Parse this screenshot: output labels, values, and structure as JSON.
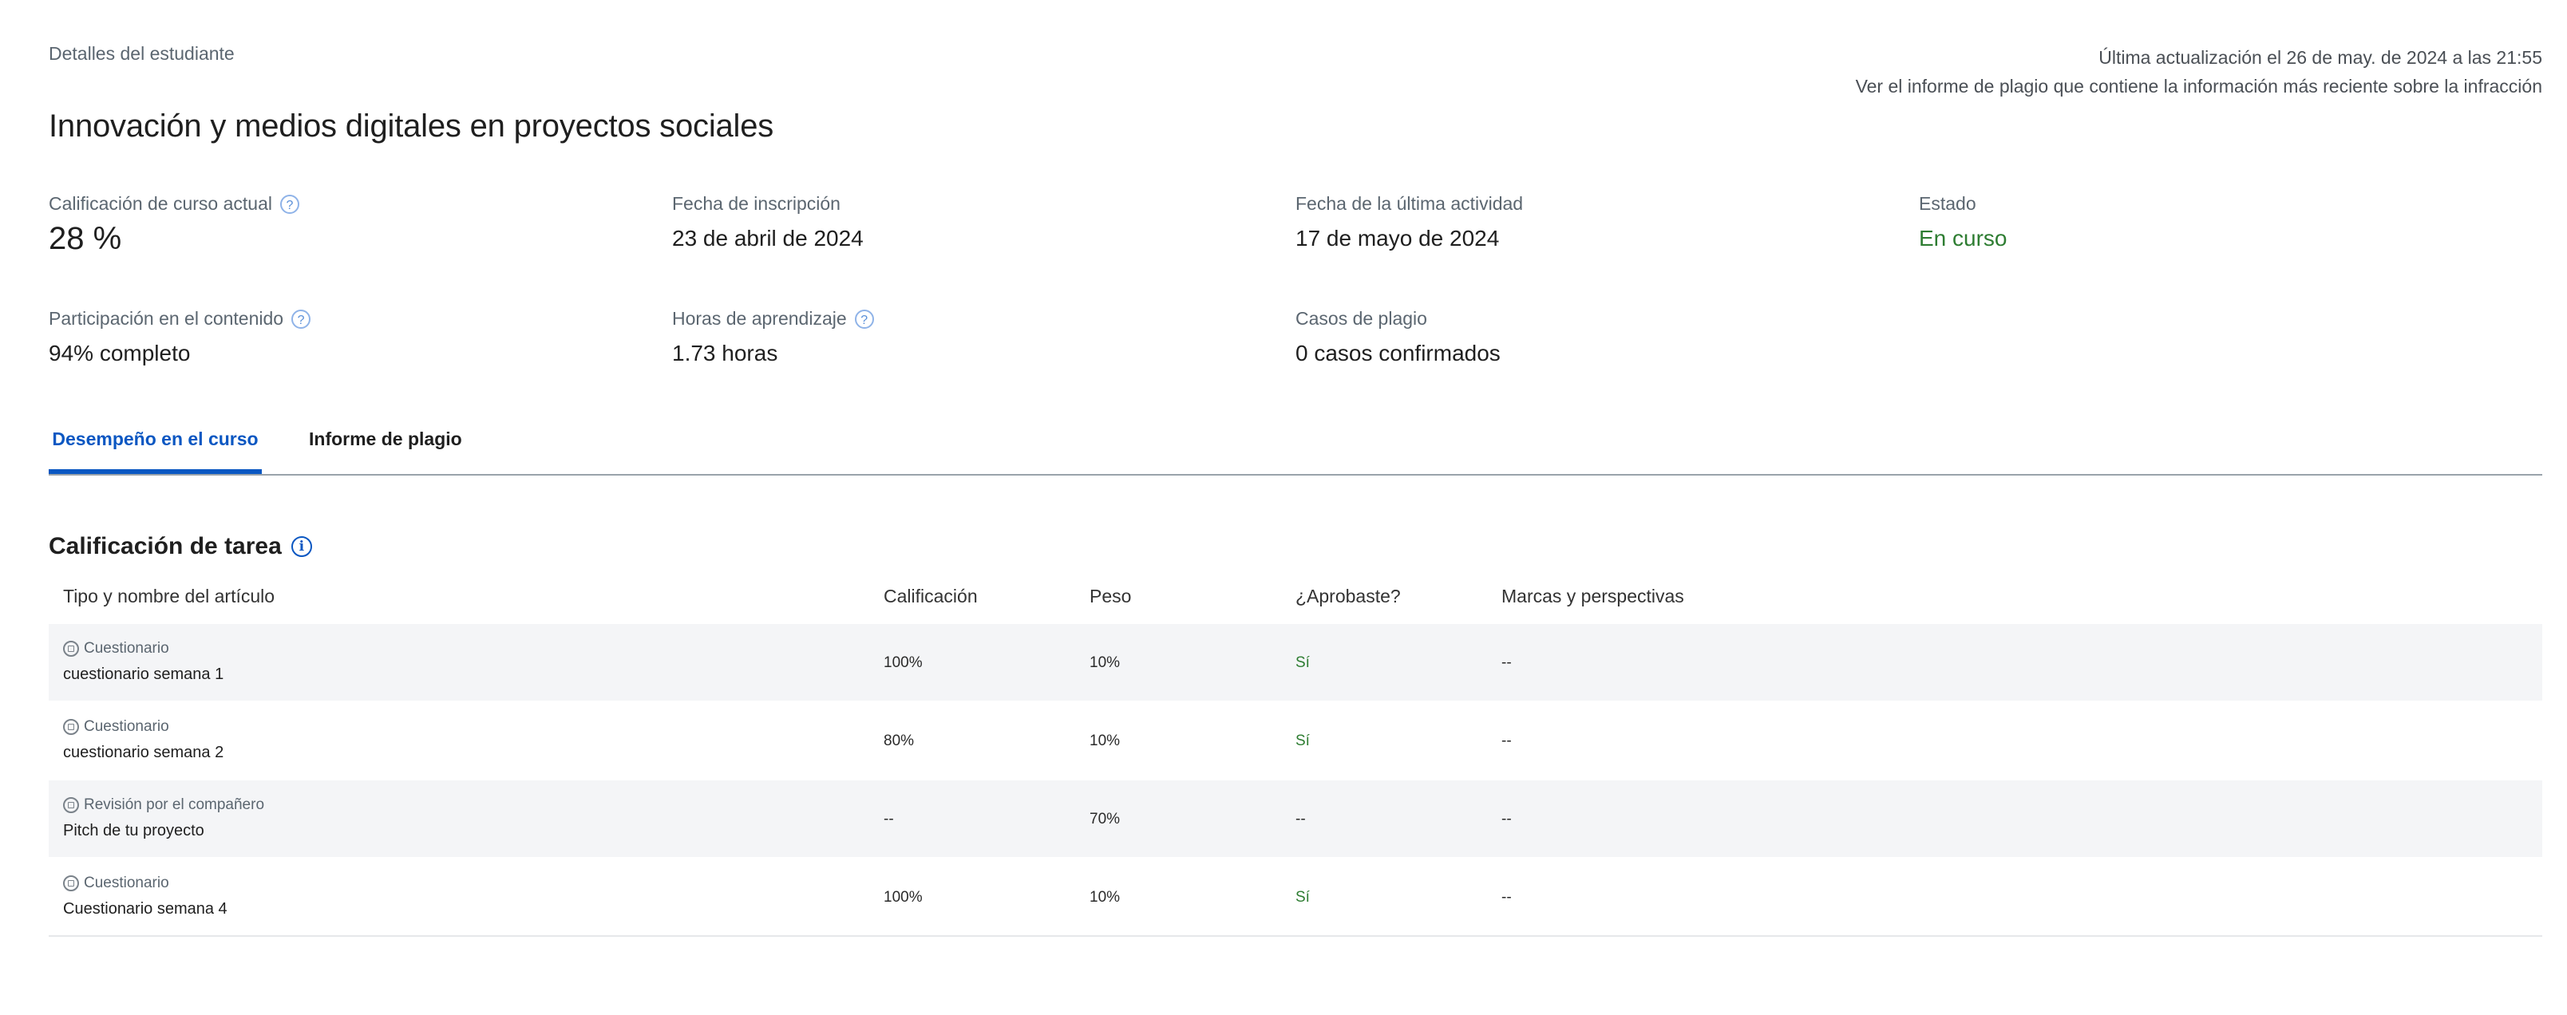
{
  "breadcrumb": "Detalles del estudiante",
  "update": {
    "last_updated": "Última actualización el 26 de may. de 2024 a las 21:55",
    "plagiarism_note": "Ver el informe de plagio que contiene la información más reciente sobre la infracción"
  },
  "course_title": "Innovación y medios digitales en proyectos sociales",
  "stats": {
    "grade": {
      "label": "Calificación de curso actual",
      "value": "28 %",
      "icon": "help-icon"
    },
    "enrollment": {
      "label": "Fecha de inscripción",
      "value": "23 de abril de 2024"
    },
    "last_activity": {
      "label": "Fecha de la última actividad",
      "value": "17 de mayo de 2024"
    },
    "status": {
      "label": "Estado",
      "value": "En curso",
      "color": "#2e7d32"
    },
    "participation": {
      "label": "Participación en el contenido",
      "value": "94% completo",
      "icon": "help-icon"
    },
    "learning_hours": {
      "label": "Horas de aprendizaje",
      "value": "1.73 horas",
      "icon": "help-icon"
    },
    "plagiarism_cases": {
      "label": "Casos de plagio",
      "value": "0 casos confirmados"
    }
  },
  "tabs": [
    {
      "label": "Desempeño en el curso",
      "active": true
    },
    {
      "label": "Informe de plagio",
      "active": false
    }
  ],
  "assignments": {
    "title": "Calificación de tarea",
    "title_icon": "info-icon",
    "columns": [
      "Tipo y nombre del artículo",
      "Calificación",
      "Peso",
      "¿Aprobaste?",
      "Marcas y perspectivas"
    ],
    "rows": [
      {
        "type": "Cuestionario",
        "type_icon": "quiz-icon",
        "name": "cuestionario semana 1",
        "grade": "100%",
        "weight": "10%",
        "passed": "Sí",
        "flags": "--"
      },
      {
        "type": "Cuestionario",
        "type_icon": "quiz-icon",
        "name": "cuestionario semana 2",
        "grade": "80%",
        "weight": "10%",
        "passed": "Sí",
        "flags": "--"
      },
      {
        "type": "Revisión por el compañero",
        "type_icon": "peer-review-icon",
        "name": "Pitch de tu proyecto",
        "grade": "--",
        "weight": "70%",
        "passed": "--",
        "flags": "--"
      },
      {
        "type": "Cuestionario",
        "type_icon": "quiz-icon",
        "name": "Cuestionario semana 4",
        "grade": "100%",
        "weight": "10%",
        "passed": "Sí",
        "flags": "--"
      }
    ]
  },
  "colors": {
    "accent": "#0a57c2",
    "success": "#2e7d32",
    "row_shade": "#f4f5f7"
  }
}
